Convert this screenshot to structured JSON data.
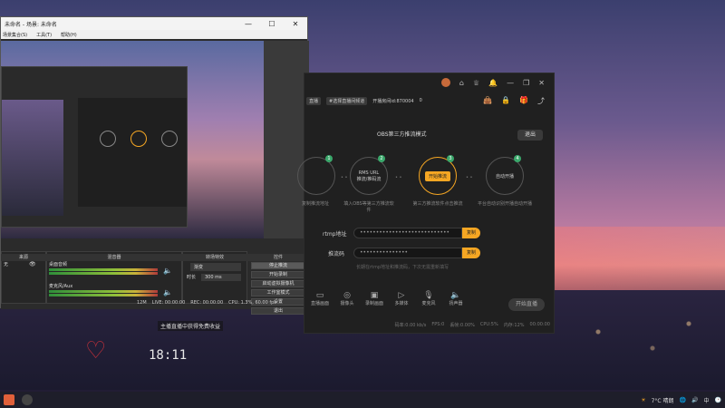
{
  "obs": {
    "title": "未命名 - 场景: 未命名",
    "window_controls": [
      "—",
      "☐",
      "✕"
    ],
    "menu": [
      "场景集合(S)",
      "工具(T)",
      "帮助(H)"
    ],
    "docks": {
      "scenes_header": "来源",
      "mixer_header": "混音器",
      "transitions_header": "转场特效",
      "controls_header": "控件",
      "scene_item": "无",
      "desktop_audio": "桌面音频",
      "mic_audio": "麦克风/Aux",
      "transition_select": "渐变",
      "duration_label": "时长",
      "duration_value": "300 ms"
    },
    "controls": [
      "停止推流",
      "开始录制",
      "启动虚拟摄像机",
      "工作室模式",
      "设置",
      "退出"
    ],
    "status": {
      "fps": "0.00 fps",
      "live_time": "LIVE: 00:00:00",
      "rec_time": "REC: 00:00:00",
      "cpu": "CPU: 1.3%, 60.00 fps",
      "kb": "12M"
    }
  },
  "tool": {
    "top_icons": [
      "avatar",
      "shirt-icon",
      "crown-icon",
      "bell-icon",
      "minimize",
      "restore",
      "close"
    ],
    "subbar": {
      "tag1": "直播",
      "tag2": "#选择直播间频道",
      "room_text": "开播房间id:870004",
      "id": "870004",
      "follow": "0"
    },
    "mode_title": "OBS第三方推流模式",
    "exit_label": "退出",
    "steps": [
      {
        "num": "1",
        "label": "",
        "caption": "复制推流地址"
      },
      {
        "num": "2",
        "label": "RMS URL",
        "sub": "推流/推码流",
        "caption": "填入OBS等第三方推流软件"
      },
      {
        "num": "3",
        "label": "开始推流",
        "caption": "第三方推流软件点击推流"
      },
      {
        "num": "4",
        "label": "自动开播",
        "caption": "平台自动识别开播自动开播"
      }
    ],
    "rtmp_label": "rtmp地址",
    "rtmp_value": "••••••••••••••••••••••••••••",
    "key_label": "推流码",
    "key_value": "•••••••••••••••",
    "copy_label": "复制",
    "hint": "长期在rtmp地址和推流码，下次无需重新填写",
    "bottom": [
      {
        "icon": "▭",
        "label": "直播画面"
      },
      {
        "icon": "◎",
        "label": "摄像头"
      },
      {
        "icon": "▣",
        "label": "录制画面"
      },
      {
        "icon": "▷",
        "label": "多媒体"
      },
      {
        "icon": "🎙",
        "label": "麦克风"
      },
      {
        "icon": "🔈",
        "label": "扬声器"
      }
    ],
    "start_label": "开始直播",
    "status_items": [
      "码率:0.00 kb/s",
      "FPS:0",
      "丢帧:0.00%",
      "CPU:5%",
      "内存:12%",
      "00:00:00"
    ]
  },
  "desktop": {
    "clock": "18:11",
    "notice": "主播直播中获得免费收益",
    "heart": "♡"
  },
  "taskbar": {
    "weather": "7°C 晴朗",
    "tray_items": [
      "🌐",
      "🔊",
      "中",
      "🕑"
    ]
  }
}
